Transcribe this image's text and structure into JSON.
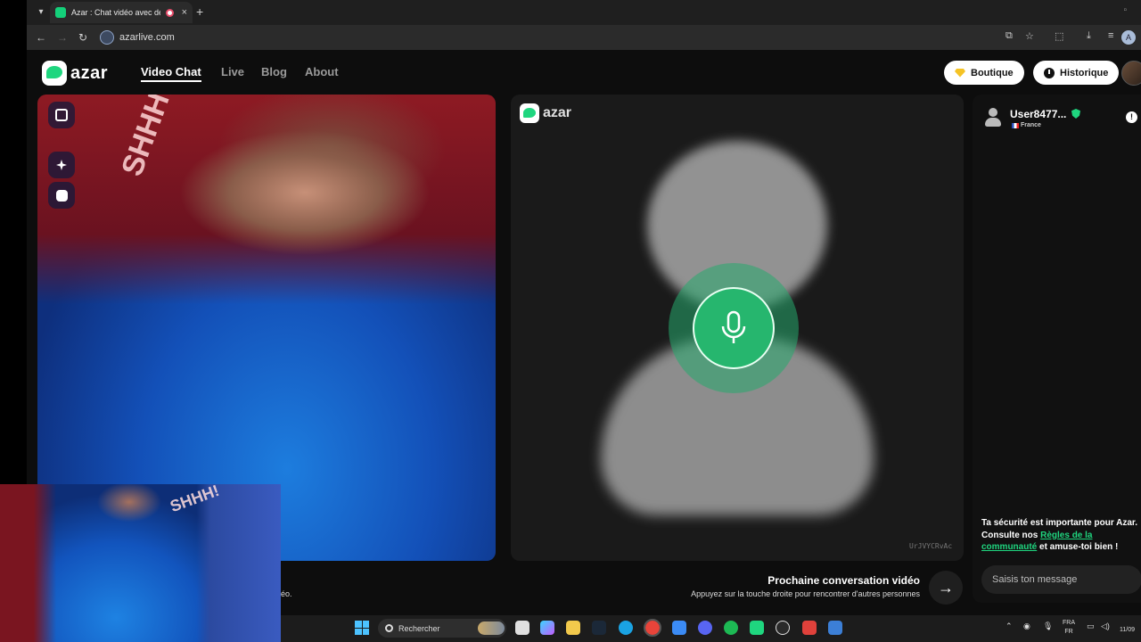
{
  "browser": {
    "tab_title": "Azar : Chat vidéo avec de n",
    "tab_close": "×",
    "new_tab": "+",
    "url": "azarlive.com",
    "profile_initial": "A"
  },
  "site": {
    "logo_text": "azar",
    "nav": [
      "Video Chat",
      "Live",
      "Blog",
      "About"
    ],
    "boutique_label": "Boutique",
    "historique_label": "Historique"
  },
  "left_video": {
    "sign_text": "SHHH!"
  },
  "right_video": {
    "logo_text": "azar",
    "stream_id": "UrJVYCRvAc"
  },
  "next": {
    "title": "Prochaine conversation vidéo",
    "subtitle": "Appuyez sur la touche droite pour rencontrer d'autres personnes",
    "arrow": "→",
    "left_caption": "éo."
  },
  "chat": {
    "username": "User8477...",
    "country": "France",
    "report": "!",
    "safety_part1": "Ta sécurité est importante pour Azar. Consulte nos ",
    "safety_link": "Règles de la communauté",
    "safety_part2": " et amuse-toi bien !",
    "input_placeholder": "Saisis ton message"
  },
  "webcam": {
    "sign_text": "SHHH!"
  },
  "taskbar": {
    "search_text": "Rechercher",
    "lang_line1": "FRA",
    "lang_line2": "FR",
    "date": "11/09"
  },
  "colors": {
    "accent_green": "#1fd67f",
    "mic_green": "#26b66e"
  }
}
